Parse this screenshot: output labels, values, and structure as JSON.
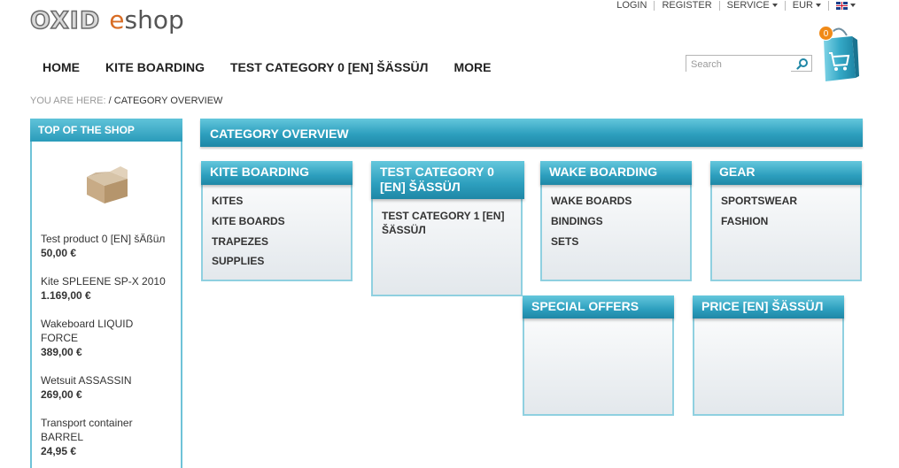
{
  "logo": {
    "brand": "OXID",
    "product_first": "e",
    "product_rest": "shop"
  },
  "top_menu": {
    "login": "LOGIN",
    "register": "REGISTER",
    "service": "SERVICE",
    "currency": "EUR"
  },
  "nav": [
    "HOME",
    "KITE BOARDING",
    "TEST CATEGORY 0 [EN] ŠÄßüл",
    "MORE"
  ],
  "nav_display": [
    "HOME",
    "KITE BOARDING",
    "TEST CATEGORY 0 [EN] ŠÄSSÜЛ",
    "MORE"
  ],
  "search": {
    "placeholder": "Search"
  },
  "basket": {
    "count": "0"
  },
  "breadcrumb": {
    "prefix": "YOU ARE HERE:",
    "separator": "/",
    "current": "CATEGORY OVERVIEW"
  },
  "sidebar": {
    "title": "TOP OF THE SHOP",
    "items": [
      {
        "name": "Test product 0 [EN] šÄßüл",
        "price": "50,00 €"
      },
      {
        "name": "Kite SPLEENE SP-X 2010",
        "price": "1.169,00 €"
      },
      {
        "name": "Wakeboard LIQUID FORCE",
        "price": "389,00 €"
      },
      {
        "name": "Wetsuit ASSASSIN",
        "price": "269,00 €"
      },
      {
        "name": "Transport container BARREL",
        "price": "24,95 €"
      }
    ]
  },
  "content": {
    "title": "CATEGORY OVERVIEW",
    "categories": [
      {
        "title": "KITE BOARDING",
        "subs": [
          "KITES",
          "KITE BOARDS",
          "TRAPEZES",
          "SUPPLIES"
        ]
      },
      {
        "title": "TEST CATEGORY 0 [EN] ŠÄSSÜЛ",
        "subs": [
          "TEST CATEGORY 1 [EN] ŠÄSSÜЛ"
        ]
      },
      {
        "title": "WAKE BOARDING",
        "subs": [
          "WAKE BOARDS",
          "BINDINGS",
          "SETS"
        ]
      },
      {
        "title": "GEAR",
        "subs": [
          "SPORTSWEAR",
          "FASHION"
        ]
      },
      {
        "title": "SPECIAL OFFERS",
        "subs": []
      },
      {
        "title": "PRICE [EN] ŠÄSSÜЛ",
        "subs": []
      }
    ]
  },
  "colors": {
    "accent": "#2d9fbe",
    "accent_light": "#64c7dc",
    "logo_orange": "#d86c24",
    "badge": "#f08a18"
  }
}
